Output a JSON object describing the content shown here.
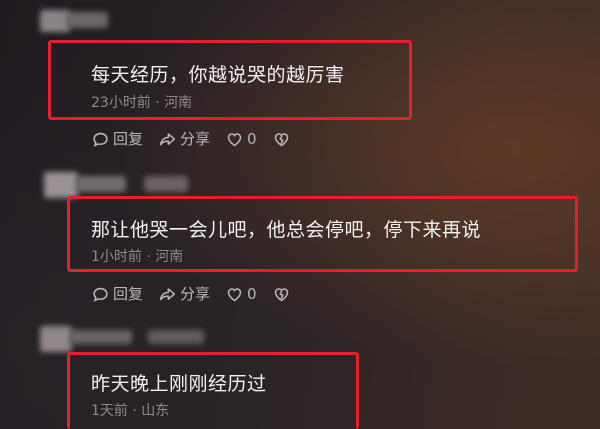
{
  "comments": [
    {
      "text": "每天经历，你越说哭的越厉害",
      "meta": "23小时前 · 河南",
      "reply_label": "回复",
      "share_label": "分享",
      "like_count": "0"
    },
    {
      "text": "那让他哭一会儿吧，他总会停吧，停下来再说",
      "meta": "1小时前 · 河南",
      "reply_label": "回复",
      "share_label": "分享",
      "like_count": "0"
    },
    {
      "text": "昨天晚上刚刚经历过",
      "meta": "1天前 · 山东"
    }
  ],
  "colors": {
    "highlight_border": "#e5202a",
    "comment_text": "#f2f2f2",
    "meta_text": "#8d8a8c",
    "action_text": "#b9b6b8"
  },
  "icons": {
    "reply": "comment-bubble-icon",
    "share": "share-arrow-icon",
    "like": "heart-icon",
    "dislike": "broken-heart-icon"
  }
}
